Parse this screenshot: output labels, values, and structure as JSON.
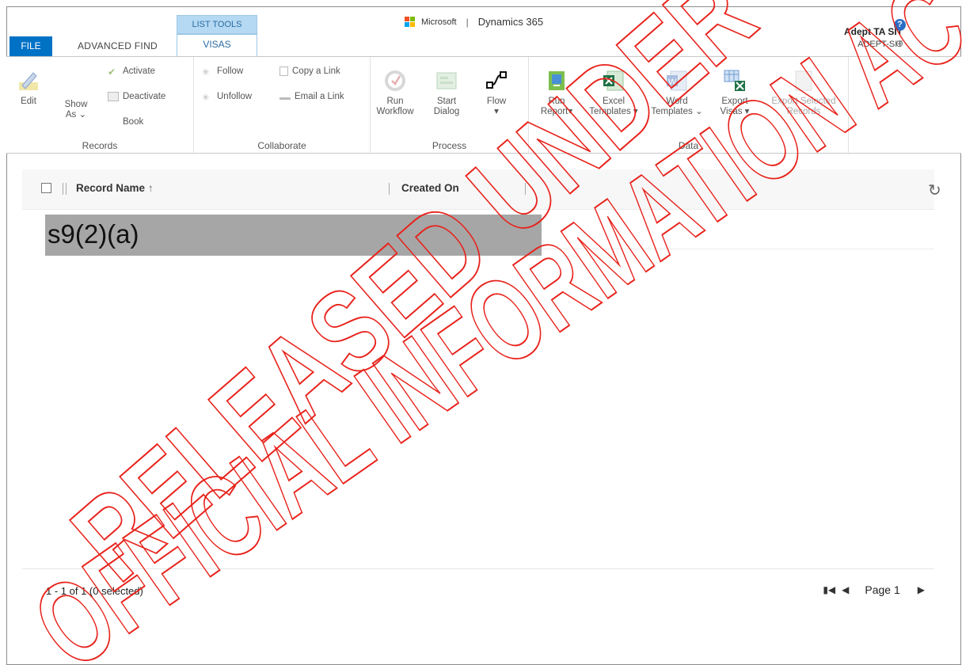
{
  "header": {
    "file_tab": "FILE",
    "advanced_find_tab": "ADVANCED FIND",
    "list_tools_label": "LIST TOOLS",
    "visas_tab": "VISAS",
    "brand_microsoft": "Microsoft",
    "brand_separator": "|",
    "brand_product": "Dynamics 365",
    "user_name": "Adept TA SIT",
    "org_name": "ADEPT-SIT"
  },
  "ribbon": {
    "records": {
      "edit": "Edit",
      "show_as_line1": "Show",
      "show_as_line2": "As",
      "activate": "Activate",
      "deactivate": "Deactivate",
      "book": "Book",
      "label": "Records"
    },
    "collaborate": {
      "follow": "Follow",
      "unfollow": "Unfollow",
      "copy_link": "Copy a Link",
      "email_link": "Email a Link",
      "label": "Collaborate"
    },
    "process": {
      "run_workflow_line1": "Run",
      "run_workflow_line2": "Workflow",
      "start_dialog_line1": "Start",
      "start_dialog_line2": "Dialog",
      "flow": "Flow",
      "label": "Process"
    },
    "data": {
      "run_report_line1": "Run",
      "run_report_line2": "Report",
      "excel_templates_line1": "Excel",
      "excel_templates_line2": "Templates",
      "word_templates_line1": "Word",
      "word_templates_line2": "Templates",
      "export_visas_line1": "Export",
      "export_visas_line2": "Visas",
      "export_selected_line1": "Export Selected",
      "export_selected_line2": "Records",
      "label": "Data"
    }
  },
  "grid": {
    "columns": [
      "Record Name",
      "Created On"
    ],
    "sort_indicator": "↑",
    "redacted_text": "s9(2)(a)",
    "status": "1 - 1 of 1 (0 selected)",
    "page_label": "Page 1"
  },
  "watermark": {
    "line1": "RELEASED UNDER THE",
    "line2": "OFFICIAL INFORMATION ACT",
    "color": "#e8221b"
  },
  "colors": {
    "file_tab": "#0072c6",
    "list_tools": "#b5d9f2",
    "redaction": "#a6a6a6"
  }
}
